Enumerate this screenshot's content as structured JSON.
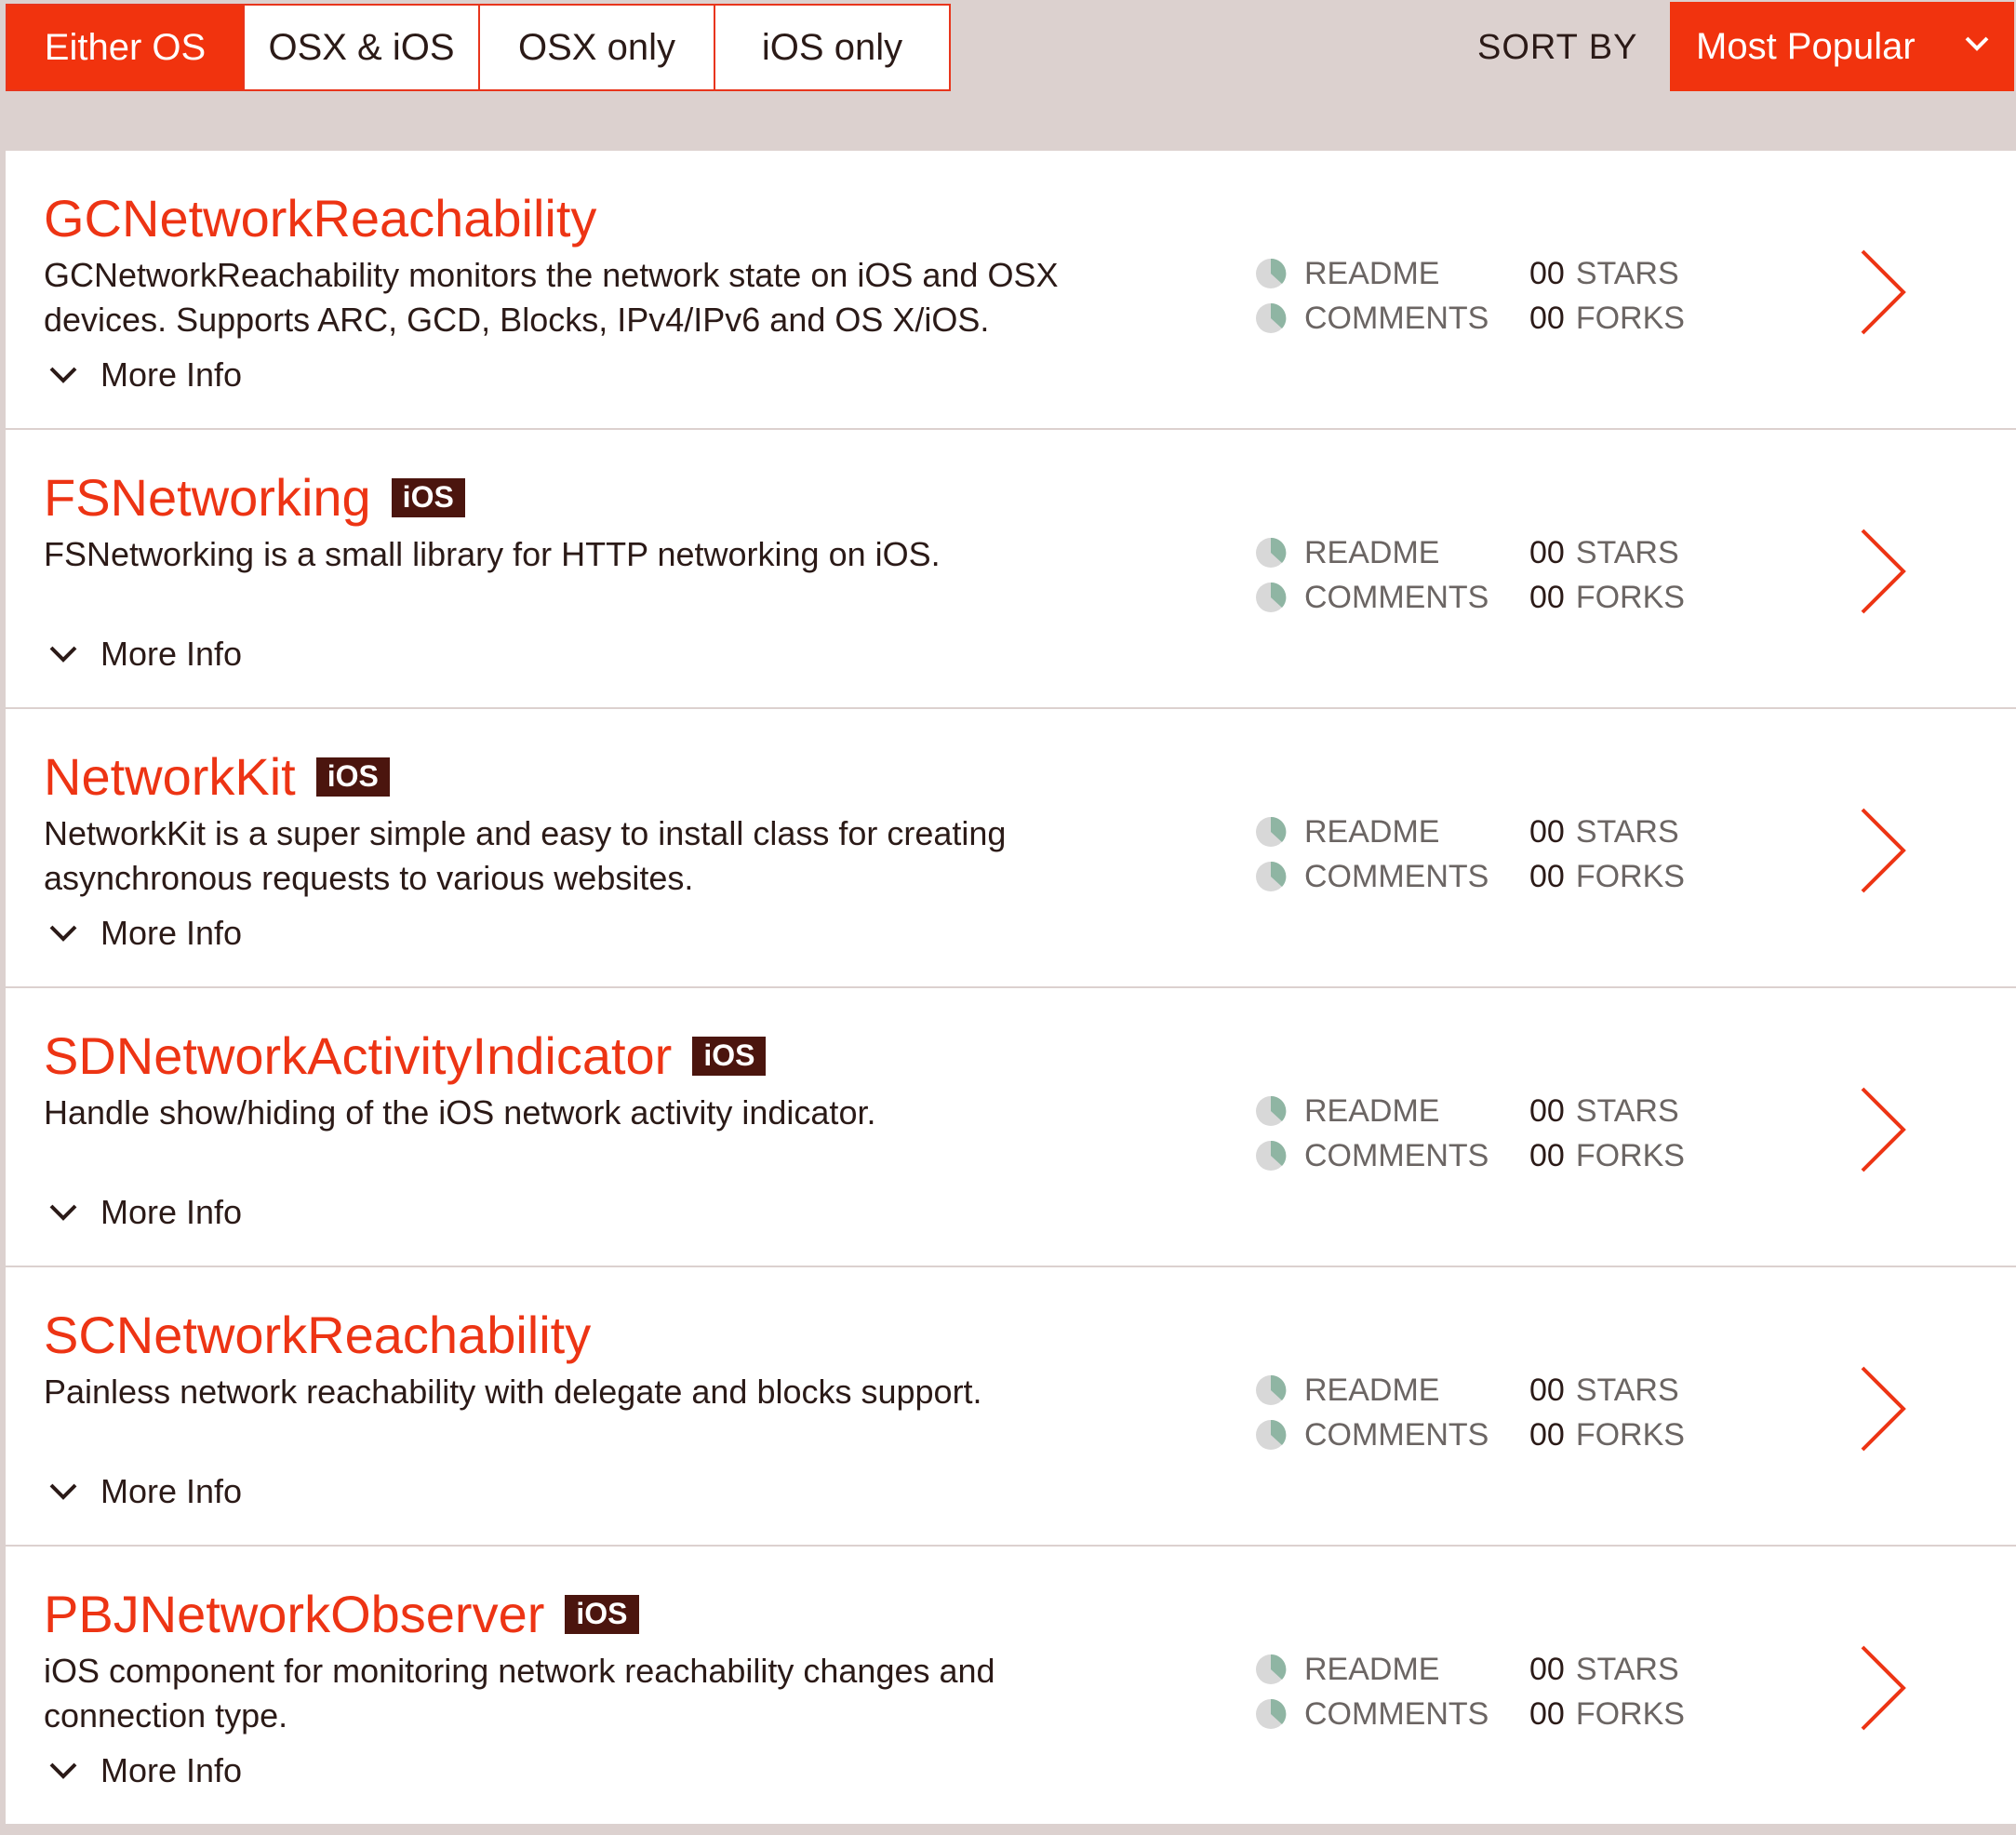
{
  "filters": {
    "items": [
      {
        "label": "Either OS",
        "active": true
      },
      {
        "label": "OSX & iOS",
        "active": false
      },
      {
        "label": "OSX only",
        "active": false
      },
      {
        "label": "iOS only",
        "active": false
      }
    ]
  },
  "sort": {
    "label": "SORT BY",
    "selected": "Most Popular"
  },
  "colors": {
    "accent": "#f1330e",
    "title": "#ed3414",
    "badge": "#4b150e",
    "pie_green": "#8fb5a3",
    "pie_gray": "#d8d8d8"
  },
  "stat_labels": {
    "readme": "README",
    "comments": "COMMENTS",
    "stars": "STARS",
    "forks": "FORKS"
  },
  "more_info_label": "More Info",
  "libraries": [
    {
      "name": "GCNetworkReachability",
      "badge": "",
      "description": "GCNetworkReachability monitors the network state on iOS and OSX devices. Supports ARC, GCD, Blocks, IPv4/IPv6 and OS X/iOS.",
      "stars": "00",
      "forks": "00"
    },
    {
      "name": "FSNetworking",
      "badge": "iOS",
      "description": "FSNetworking is a small library for HTTP networking on iOS.",
      "stars": "00",
      "forks": "00"
    },
    {
      "name": "NetworkKit",
      "badge": "iOS",
      "description": "NetworkKit is a super simple and easy to install class for creating asynchronous requests to various websites.",
      "stars": "00",
      "forks": "00"
    },
    {
      "name": "SDNetworkActivityIndicator",
      "badge": "iOS",
      "description": "Handle show/hiding of the iOS network activity indicator.",
      "stars": "00",
      "forks": "00"
    },
    {
      "name": "SCNetworkReachability",
      "badge": "",
      "description": "Painless network reachability with delegate and blocks support.",
      "stars": "00",
      "forks": "00"
    },
    {
      "name": "PBJNetworkObserver",
      "badge": "iOS",
      "description": "iOS component for monitoring network reachability changes and connection type.",
      "stars": "00",
      "forks": "00"
    }
  ]
}
